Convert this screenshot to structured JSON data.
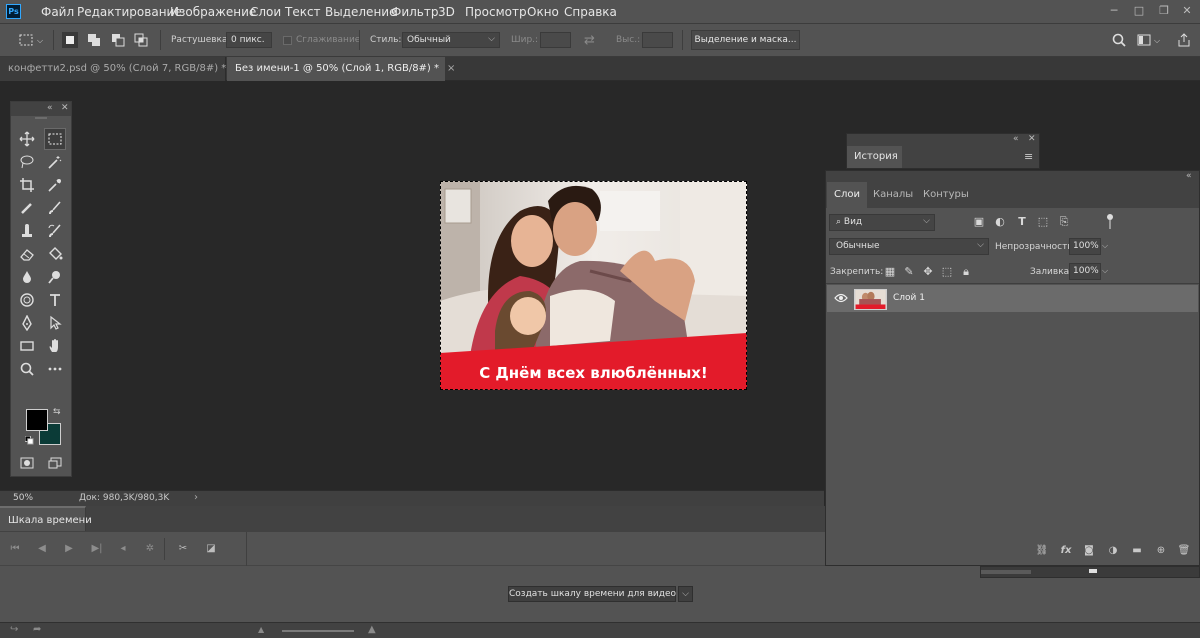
{
  "app": {
    "logo": "Ps"
  },
  "menu": [
    "Файл",
    "Редактирование",
    "Изображение",
    "Слои",
    "Текст",
    "Выделение",
    "Фильтр",
    "3D",
    "Просмотр",
    "Окно",
    "Справка"
  ],
  "window_controls": [
    "minimize-icon",
    "maximize-icon",
    "close-icon"
  ],
  "options": {
    "feather_label": "Растушевка:",
    "feather_value": "0 пикс.",
    "antialias_label": "Сглаживание",
    "style_label": "Стиль:",
    "style_value": "Обычный",
    "width_label": "Шир.:",
    "height_label": "Выс.:",
    "select_mask_button": "Выделение и маска..."
  },
  "tabs": [
    {
      "label": "конфетти2.psd @ 50% (Слой 7, RGB/8#) *",
      "close": "×"
    },
    {
      "label": "Без имени-1 @ 50% (Слой 1, RGB/8#) *",
      "close": "×"
    }
  ],
  "document": {
    "banner_text": "С Днём всех влюблённых!"
  },
  "colors": {
    "foreground": "#000000",
    "background": "#0b3b37",
    "banner_red": "#e31b2a",
    "ui_panel": "#535353",
    "canvas_bg": "#282828"
  },
  "status": {
    "zoom": "50%",
    "doc_info": "Док: 980,3K/980,3K"
  },
  "timeline": {
    "tab_label": "Шкала времени",
    "create_button": "Создать шкалу времени для видео"
  },
  "history": {
    "tab_label": "История"
  },
  "layers_panel": {
    "tabs": [
      "Слои",
      "Каналы",
      "Контуры"
    ],
    "filter_label": "Вид",
    "blend_mode": "Обычные",
    "opacity_label": "Непрозрачность:",
    "opacity_value": "100%",
    "lock_label": "Закрепить:",
    "fill_label": "Заливка:",
    "fill_value": "100%",
    "layers": [
      {
        "name": "Слой 1",
        "visible": true
      }
    ]
  }
}
